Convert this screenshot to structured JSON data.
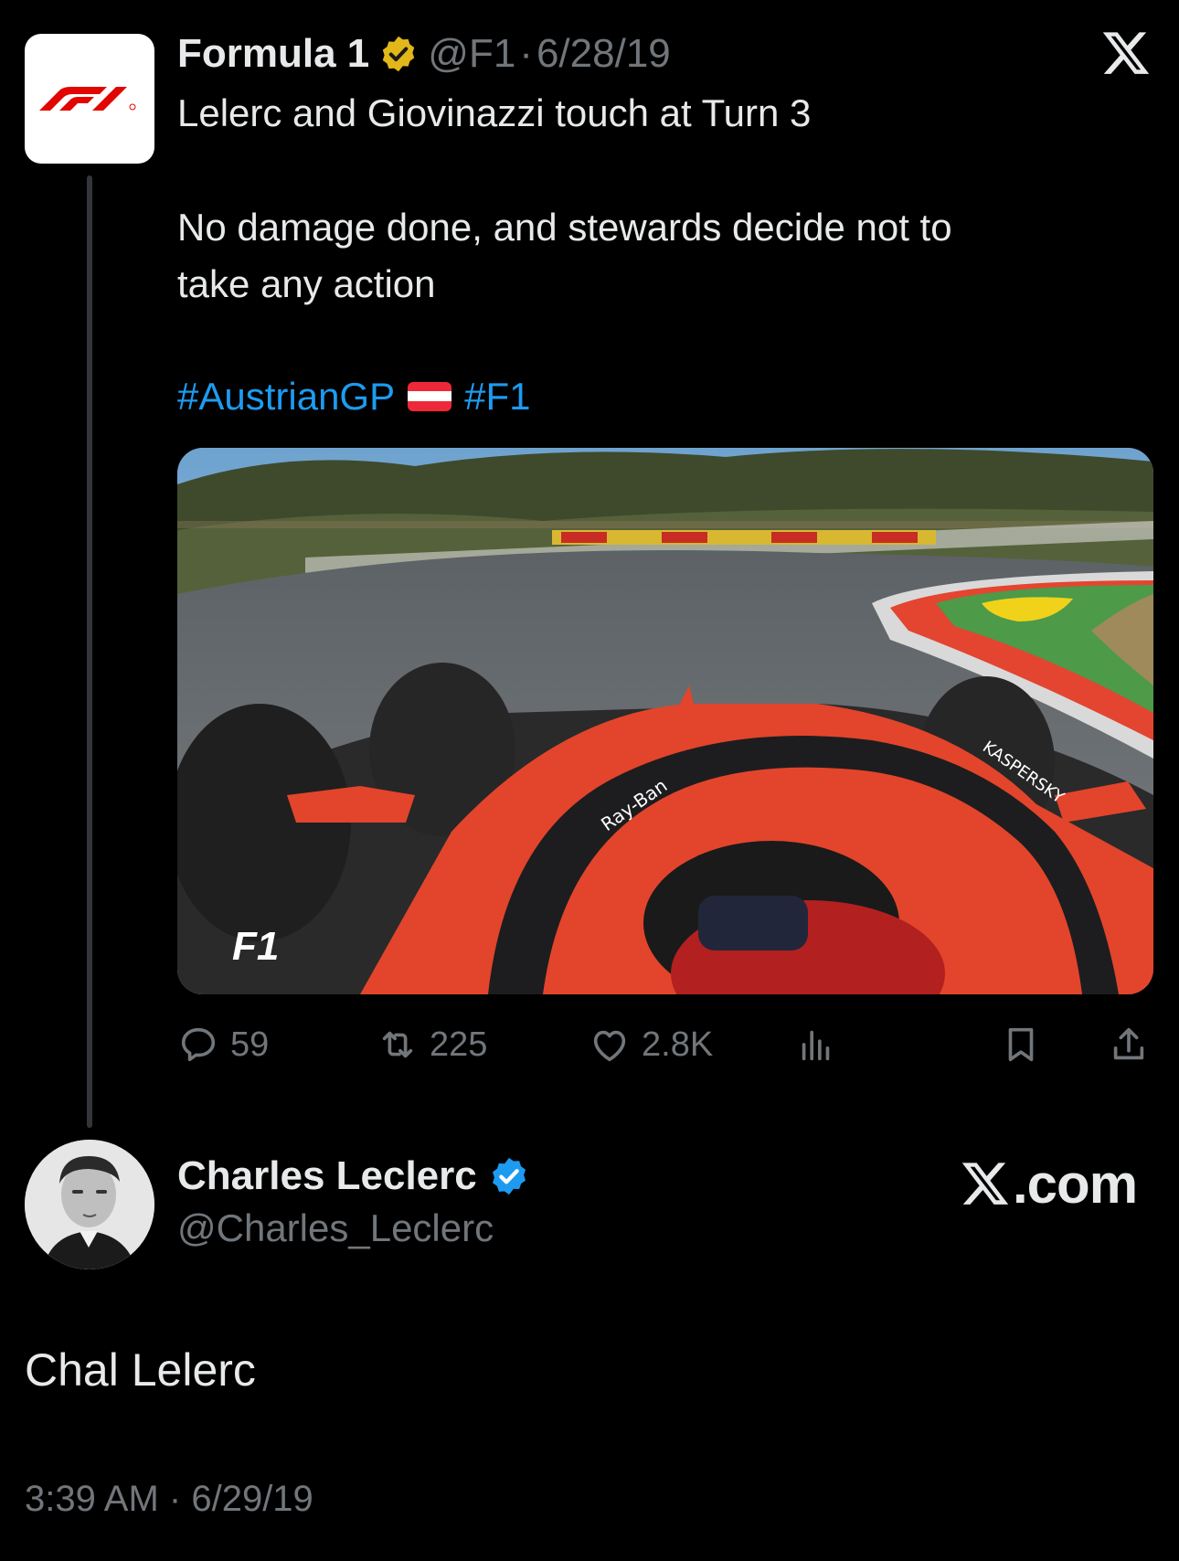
{
  "quoted_tweet": {
    "author_name": "Formula 1",
    "author_handle": "@F1",
    "separator": "·",
    "date": "6/28/19",
    "logo_icon": "f1-logo",
    "text_line1": "Lelerc and Giovinazzi touch at Turn 3",
    "text_line2": "No damage done, and stewards decide not to",
    "text_line3": "take any action",
    "hashtags": [
      "#AustrianGP",
      "#F1"
    ],
    "flag": "austria-flag",
    "media_overlay": "F1",
    "stats": {
      "replies": "59",
      "retweets": "225",
      "likes": "2.8K"
    }
  },
  "reply": {
    "author_name": "Charles Leclerc",
    "author_handle": "@Charles_Leclerc",
    "text": "Chal Lelerc",
    "time": "3:39 AM",
    "separator": "·",
    "date": "6/29/19"
  },
  "branding": {
    "site": ".com"
  },
  "colors": {
    "background": "#000000",
    "text": "#e7e9ea",
    "muted": "#71767b",
    "link": "#1d9bf0",
    "gold_badge": "#e2b719",
    "blue_badge": "#1d9bf0",
    "f1_red": "#e10600"
  }
}
